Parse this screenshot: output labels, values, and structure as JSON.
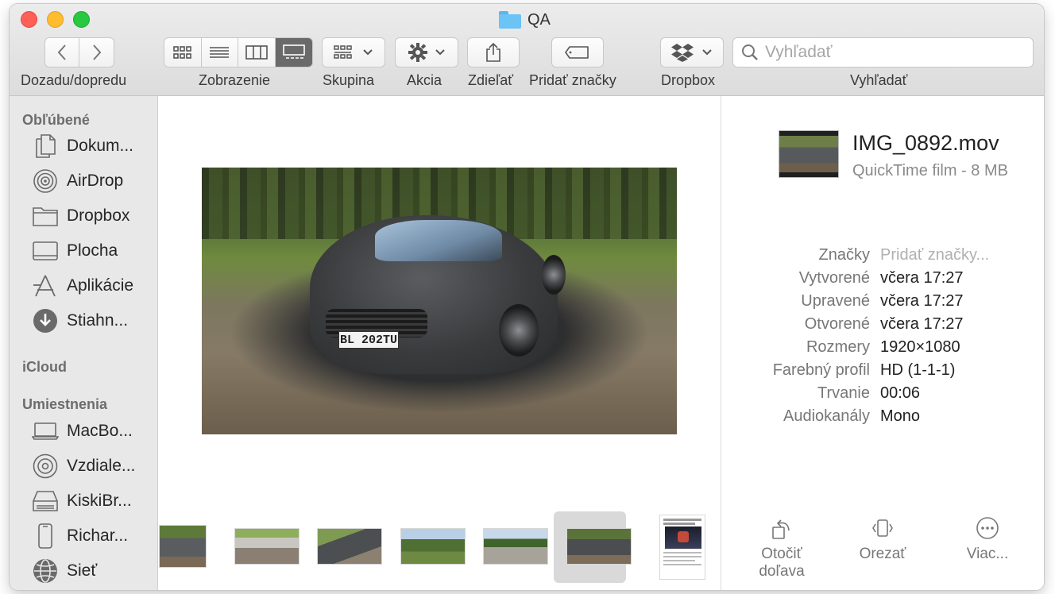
{
  "window": {
    "title": "QA"
  },
  "toolbar": {
    "nav_label": "Dozadu/dopredu",
    "view_label": "Zobrazenie",
    "group_label": "Skupina",
    "action_label": "Akcia",
    "share_label": "Zdieľať",
    "tags_label": "Pridať značky",
    "dropbox_label": "Dropbox",
    "search_label": "Vyhľadať",
    "search_placeholder": "Vyhľadať",
    "active_view": "gallery"
  },
  "sidebar": {
    "favorites_header": "Obľúbené",
    "favorites": [
      {
        "label": "Dokum...",
        "icon": "documents-icon"
      },
      {
        "label": "AirDrop",
        "icon": "airdrop-icon"
      },
      {
        "label": "Dropbox",
        "icon": "folder-icon"
      },
      {
        "label": "Plocha",
        "icon": "desktop-icon"
      },
      {
        "label": "Aplikácie",
        "icon": "applications-icon"
      },
      {
        "label": "Stiahn...",
        "icon": "downloads-icon"
      }
    ],
    "icloud_header": "iCloud",
    "locations_header": "Umiestnenia",
    "locations": [
      {
        "label": "MacBo...",
        "icon": "laptop-icon"
      },
      {
        "label": "Vzdiale...",
        "icon": "disc-icon"
      },
      {
        "label": "KiskiBr...",
        "icon": "drive-icon"
      },
      {
        "label": "Richar...",
        "icon": "phone-icon"
      },
      {
        "label": "Sieť",
        "icon": "network-icon"
      }
    ]
  },
  "preview": {
    "plate_text": "BL 202TU"
  },
  "info": {
    "file_name": "IMG_0892.mov",
    "file_kind": "QuickTime film - 8 MB",
    "metadata": [
      {
        "key": "Značky",
        "value": "Pridať značky..."
      },
      {
        "key": "Vytvorené",
        "value": "včera 17:27"
      },
      {
        "key": "Upravené",
        "value": "včera 17:27"
      },
      {
        "key": "Otvorené",
        "value": "včera 17:27"
      },
      {
        "key": "Rozmery",
        "value": "1920×1080"
      },
      {
        "key": "Farebný profil",
        "value": "HD (1-1-1)"
      },
      {
        "key": "Trvanie",
        "value": "00:06"
      },
      {
        "key": "Audiokanály",
        "value": "Mono"
      }
    ],
    "actions": {
      "rotate_line1": "Otočiť",
      "rotate_line2": "doľava",
      "trim": "Orezať",
      "more": "Viac..."
    }
  },
  "colors": {
    "close": "#fe5f57",
    "minimize": "#febc2e",
    "zoom": "#28c840",
    "folder": "#6cc3f5",
    "sidebar_bg": "#e8e8e8",
    "selected_thumb_bg": "#d9d9d9"
  }
}
